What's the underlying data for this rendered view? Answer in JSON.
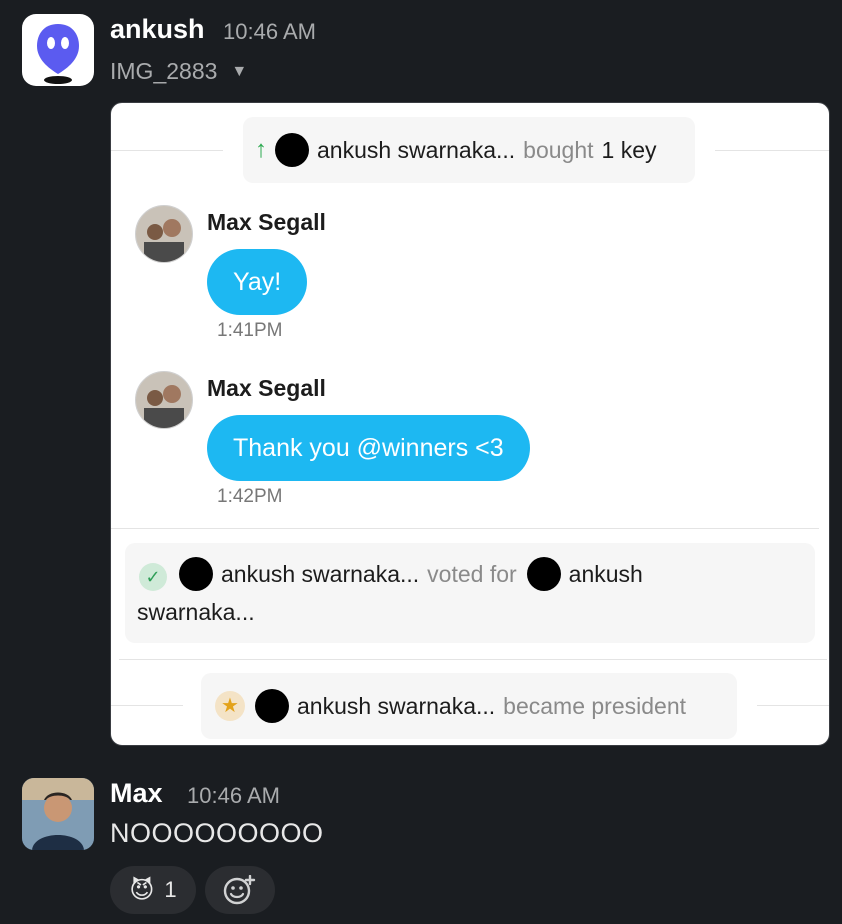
{
  "message1": {
    "sender": "ankush",
    "time": "10:46 AM",
    "filename": "IMG_2883",
    "screenshot": {
      "top_event": {
        "name": "ankush swarnaka...",
        "action": "bought",
        "object": "1 key"
      },
      "chats": [
        {
          "name": "Max Segall",
          "text": "Yay!",
          "time": "1:41PM"
        },
        {
          "name": "Max Segall",
          "text": "Thank you @winners <3",
          "time": "1:42PM"
        }
      ],
      "vote_event": {
        "voter": "ankush swarnaka...",
        "action": "voted for",
        "target_first": "ankush",
        "target_second": "swarnaka..."
      },
      "president_event": {
        "name": "ankush swarnaka...",
        "action": "became president"
      }
    }
  },
  "message2": {
    "sender": "Max",
    "time": "10:46 AM",
    "text": "NOOOOOOOOO",
    "reactions": [
      {
        "emoji": "😈",
        "count": "1"
      }
    ]
  },
  "colors": {
    "background": "#1a1d21",
    "bubble": "#1db8f2",
    "app_icon": "#5b5bf0"
  },
  "icons": {
    "caret": "chevron-down-icon",
    "add_reaction": "add-reaction-icon",
    "vote_check": "check-circle-icon",
    "president_star": "star-icon",
    "up_arrow": "up-arrow-icon"
  }
}
